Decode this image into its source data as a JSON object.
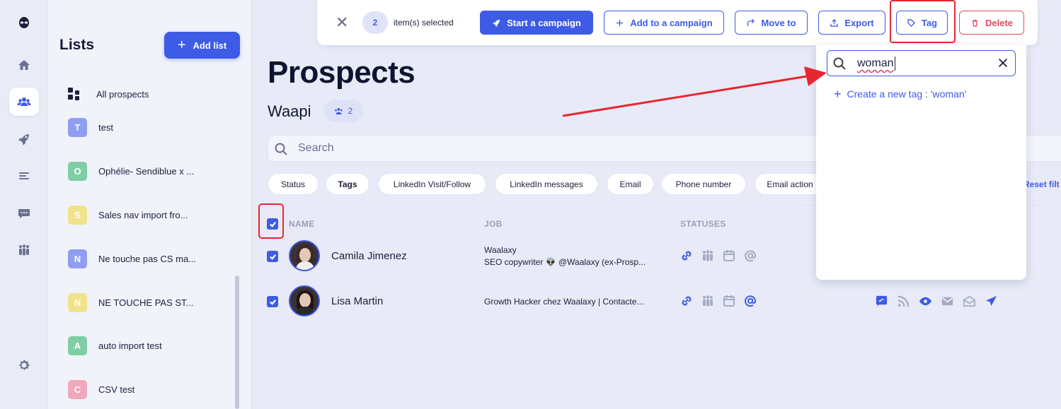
{
  "lists_panel": {
    "title": "Lists",
    "add_list_label": "Add list",
    "all_prospects_label": "All prospects",
    "items": [
      {
        "letter": "T",
        "label": "test",
        "color": "#8f9ef0"
      },
      {
        "letter": "O",
        "label": "Ophélie- Sendiblue x ...",
        "color": "#7fcea5"
      },
      {
        "letter": "S",
        "label": "Sales nav import fro...",
        "color": "#f1e28c"
      },
      {
        "letter": "N",
        "label": "Ne touche pas CS ma...",
        "color": "#8f9ef0"
      },
      {
        "letter": "N",
        "label": "NE TOUCHE PAS ST...",
        "color": "#f1e28c"
      },
      {
        "letter": "A",
        "label": "auto import test",
        "color": "#7fcea5"
      },
      {
        "letter": "C",
        "label": "CSV test",
        "color": "#f0a8bd"
      }
    ]
  },
  "toolbar": {
    "selected_count": "2",
    "selected_text": "item(s) selected",
    "start_campaign": "Start a campaign",
    "add_to_campaign": "Add to a campaign",
    "move_to": "Move to",
    "export": "Export",
    "tag": "Tag",
    "delete": "Delete"
  },
  "page": {
    "title": "Prospects",
    "list_name": "Waapi",
    "member_count": "2",
    "search_placeholder": "Search",
    "reset_filters": "Reset filt"
  },
  "filters": [
    "Status",
    "Tags",
    "LinkedIn Visit/Follow",
    "LinkedIn messages",
    "Email",
    "Phone number",
    "Email action"
  ],
  "table": {
    "columns": {
      "name": "NAME",
      "job": "JOB",
      "statuses": "STATUSES"
    },
    "rows": [
      {
        "name": "Camila Jimenez",
        "job_line1": "Waalaxy",
        "job_line2": "SEO copywriter 👽 @Waalaxy (ex-Prosp..."
      },
      {
        "name": "Lisa Martin",
        "job_line1": "Growth Hacker chez Waalaxy | Contacte...",
        "job_line2": ""
      }
    ]
  },
  "tag_dropdown": {
    "search_value": "woman",
    "create_label": "Create a new tag : 'woman'"
  },
  "colors": {
    "accent": "#3e5be6",
    "danger": "#e34b5f",
    "annotation": "#e8262f"
  }
}
